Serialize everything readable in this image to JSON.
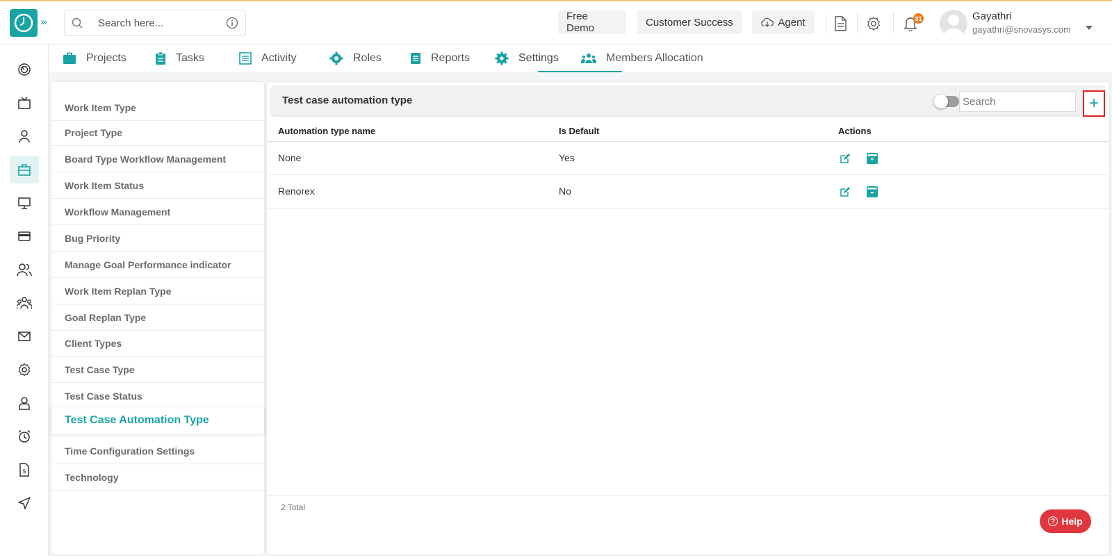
{
  "header": {
    "search_placeholder": "Search here...",
    "buttons": {
      "free_demo": "Free Demo",
      "customer_success": "Customer Success",
      "agent": "Agent"
    },
    "notification_count": "31",
    "user": {
      "name": "Gayathri",
      "email": "gayathri@snovasys.com"
    }
  },
  "sidebar": {
    "icons": [
      "dashboard-icon",
      "tv-icon",
      "user-icon",
      "briefcase-icon",
      "monitor-icon",
      "card-icon",
      "users-icon",
      "team-icon",
      "mail-icon",
      "settings-icon",
      "profile-icon",
      "alarm-icon",
      "invoice-icon",
      "send-icon"
    ],
    "active_index": 3
  },
  "tabs": [
    {
      "label": "Projects"
    },
    {
      "label": "Tasks"
    },
    {
      "label": "Activity"
    },
    {
      "label": "Roles"
    },
    {
      "label": "Reports"
    },
    {
      "label": "Settings",
      "active": true
    },
    {
      "label": "Members Allocation"
    }
  ],
  "settings_menu": [
    "Work Item Type",
    "Project Type",
    "Board Type Workflow Management",
    "Work Item Status",
    "Workflow Management",
    "Bug Priority",
    "Manage Goal Performance indicator",
    "Work Item Replan Type",
    "Goal Replan Type",
    "Client Types",
    "Test Case Type",
    "Test Case Status",
    "Test Case Automation Type",
    "Time Configuration Settings",
    "Technology"
  ],
  "settings_menu_active": "Test Case Automation Type",
  "panel": {
    "title": "Test case automation type",
    "search_placeholder": "Search",
    "add_label": "+",
    "columns": [
      "Automation type name",
      "Is Default",
      "Actions"
    ],
    "rows": [
      {
        "name": "None",
        "is_default": "Yes"
      },
      {
        "name": "Renorex",
        "is_default": "No"
      }
    ],
    "total": "2 Total"
  },
  "help_label": "Help",
  "colors": {
    "accent": "#1aa3a3",
    "highlight_border": "#e02020",
    "help": "#e0363e",
    "badge": "#f07b1d"
  }
}
